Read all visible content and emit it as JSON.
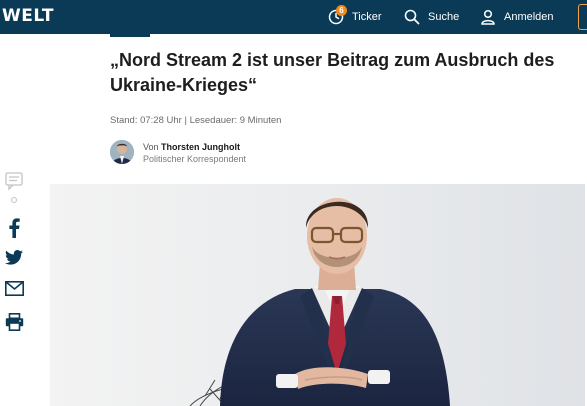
{
  "header": {
    "logo": "WELT",
    "ticker_label": "Ticker",
    "ticker_badge": "6",
    "search_label": "Suche",
    "login_label": "Anmelden",
    "colors": {
      "bar": "#0a3a55",
      "badge": "#f08a1c"
    }
  },
  "article": {
    "headline": "„Nord Stream 2 ist unser Beitrag zum Ausbruch des Ukraine-Krieges“",
    "meta": "Stand: 07:28 Uhr | Lesedauer: 9 Minuten",
    "author": {
      "prefix": "Von",
      "name": "Thorsten Jungholt",
      "role": "Politischer Korrespondent"
    }
  },
  "share": {
    "icons": [
      "comment-icon",
      "facebook-icon",
      "twitter-icon",
      "email-icon",
      "print-icon"
    ]
  }
}
